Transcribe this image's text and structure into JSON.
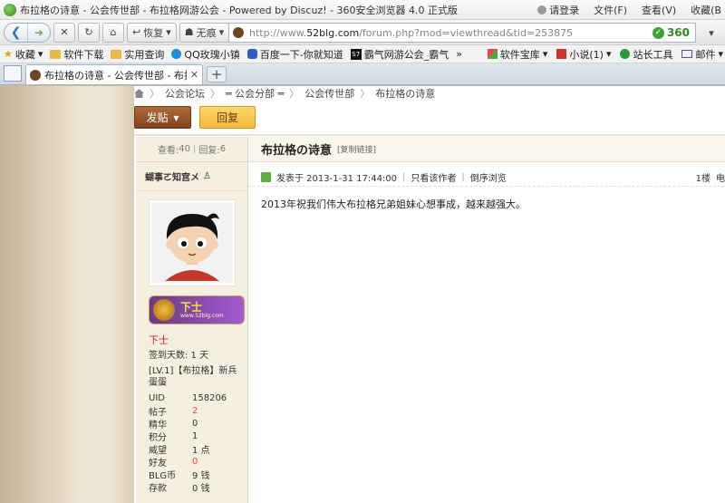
{
  "window": {
    "title": "布拉格の诗意 - 公会传世部 - 布拉格网游公会 - Powered by Discuz! - 360安全浏览器 4.0 正式版",
    "menu": [
      "请登录",
      "文件(F)",
      "查看(V)",
      "收藏(B"
    ]
  },
  "nav": {
    "restore": "恢复",
    "no_trace": "无痕",
    "url_prefix": "http://www.",
    "url_host": "52blg.com",
    "url_path": "/forum.php?mod=viewthread&tid=253875",
    "badge": "360"
  },
  "bookmarks": {
    "left": [
      "收藏",
      "软件下载",
      "实用查询",
      "QQ玫瑰小镇",
      "百度一下-你就知道",
      "霸气网游公会_霸气"
    ],
    "more": "»",
    "right": [
      "软件宝库",
      "小说(1)",
      "站长工具",
      "邮件"
    ]
  },
  "tab": {
    "label": "布拉格の诗意 - 公会传世部 - 布拉格..."
  },
  "breadcrumb": [
    "公会论坛",
    "═ 公会分部 ═",
    "公会传世部",
    "布拉格の诗意"
  ],
  "buttons": {
    "post": "发贴",
    "reply": "回复"
  },
  "stats": {
    "views_label": "查看:",
    "views": "40",
    "replies_label": "回复:",
    "replies": "6"
  },
  "author": {
    "name": "蝴事ㄛ知宫メ"
  },
  "rank": {
    "badge_text": "下士",
    "badge_sub": "www.52blg.com",
    "name": "下士",
    "sign_days": "签到天数: 1 天",
    "level": "[LV.1]【布拉格】新兵蛋蛋"
  },
  "profile": [
    {
      "k": "UID",
      "v": "158206"
    },
    {
      "k": "帖子",
      "v": "2"
    },
    {
      "k": "精华",
      "v": "0"
    },
    {
      "k": "积分",
      "v": "1"
    },
    {
      "k": "威望",
      "v": "1 点"
    },
    {
      "k": "好友",
      "v": "0"
    },
    {
      "k": "BLG币",
      "v": "9 钱"
    },
    {
      "k": "存款",
      "v": "0 钱"
    }
  ],
  "post": {
    "title": "布拉格の诗意",
    "copy_link": "[复制链接]",
    "posted_at": "发表于 2013-1-31 17:44:00",
    "only_author": "只看该作者",
    "reverse": "倒序浏览",
    "floor": "1楼",
    "edge": "电",
    "body": "2013年祝我们伟大布拉格兄弟姐妹心想事成，越来越强大。"
  }
}
